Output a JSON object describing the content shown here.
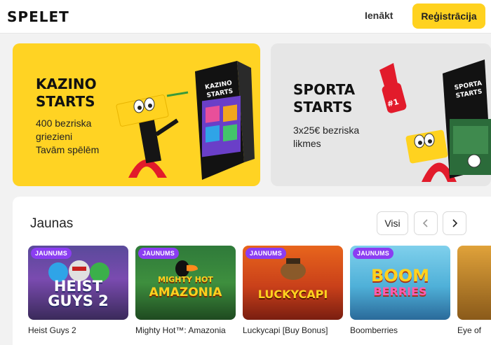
{
  "header": {
    "logo": "SPELET",
    "login_label": "Ienākt",
    "register_label": "Reģistrācija"
  },
  "promos": [
    {
      "title_line1": "KAZINO",
      "title_line2": "STARTS",
      "desc_line1": "400 bezriska",
      "desc_line2": "griezieni",
      "desc_line3": "Tavām spēlēm",
      "box_label_line1": "KAZINO",
      "box_label_line2": "STARTS"
    },
    {
      "title_line1": "SPORTA",
      "title_line2": "STARTS",
      "desc_line1": "3x25€ bezriska",
      "desc_line2": "likmes",
      "box_label_line1": "SPORTA",
      "box_label_line2": "STARTS",
      "hand_label": "#1"
    }
  ],
  "section": {
    "title": "Jaunas",
    "all_label": "Visi"
  },
  "games": [
    {
      "badge": "JAUNUMS",
      "thumb_line1": "HEIST",
      "thumb_line2": "GUYS 2",
      "name": "Heist Guys 2"
    },
    {
      "badge": "JAUNUMS",
      "thumb_line1": "MIGHTY HOT",
      "thumb_line2": "AMAZONIA",
      "name": "Mighty Hot™: Amazonia"
    },
    {
      "badge": "JAUNUMS",
      "thumb_line1": "LUCKYCAPI",
      "name": "Luckycapi [Buy Bonus]"
    },
    {
      "badge": "JAUNUMS",
      "thumb_line1": "BOOM",
      "thumb_line2": "BERRIES",
      "name": "Boomberries"
    },
    {
      "name": "Eye of"
    }
  ],
  "colors": {
    "accent_yellow": "#ffd21f",
    "badge_purple": "#8b3df2"
  }
}
